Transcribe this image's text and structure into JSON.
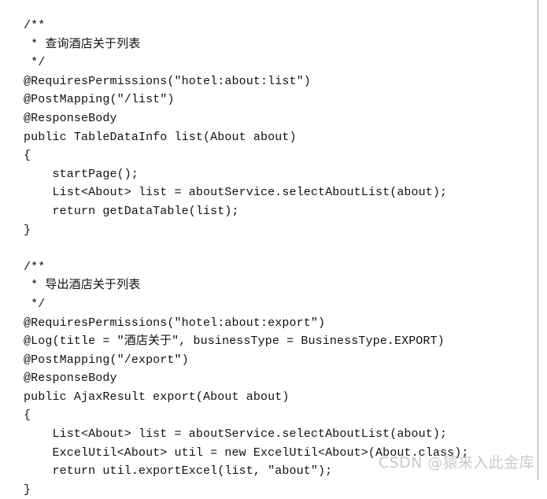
{
  "document": {
    "kind": "code-snippet",
    "language": "Java",
    "background_color": "#ffffff",
    "text_color": "#111111"
  },
  "code": {
    "lines": [
      "/**",
      " * 查询酒店关于列表",
      " */",
      "@RequiresPermissions(\"hotel:about:list\")",
      "@PostMapping(\"/list\")",
      "@ResponseBody",
      "public TableDataInfo list(About about)",
      "{",
      "    startPage();",
      "    List<About> list = aboutService.selectAboutList(about);",
      "    return getDataTable(list);",
      "}",
      "",
      "/**",
      " * 导出酒店关于列表",
      " */",
      "@RequiresPermissions(\"hotel:about:export\")",
      "@Log(title = \"酒店关于\", businessType = BusinessType.EXPORT)",
      "@PostMapping(\"/export\")",
      "@ResponseBody",
      "public AjaxResult export(About about)",
      "{",
      "    List<About> list = aboutService.selectAboutList(about);",
      "    ExcelUtil<About> util = new ExcelUtil<About>(About.class);",
      "    return util.exportExcel(list, \"about\");",
      "}"
    ]
  },
  "watermark": {
    "text": "CSDN @猿来入此金库",
    "color": "#c9c9c9"
  }
}
